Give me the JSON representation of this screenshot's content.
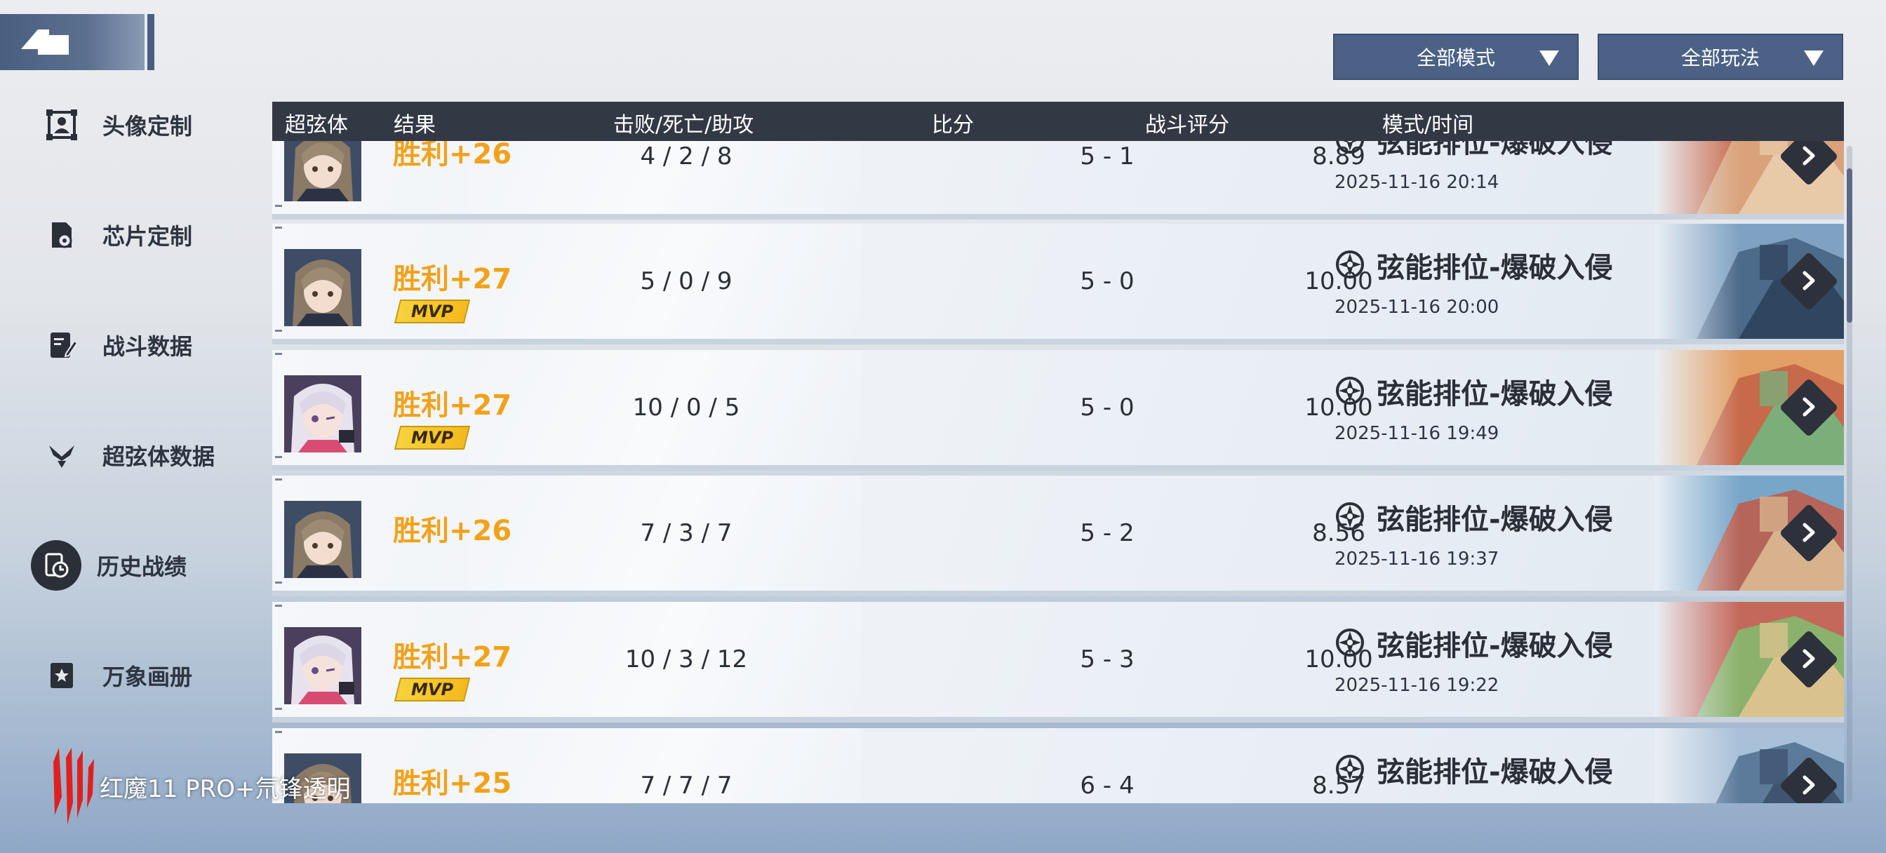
{
  "sidebar": {
    "items": [
      {
        "label": "头像定制",
        "icon": "portrait-frame-icon"
      },
      {
        "label": "芯片定制",
        "icon": "chip-icon"
      },
      {
        "label": "战斗数据",
        "icon": "battle-data-icon"
      },
      {
        "label": "超弦体数据",
        "icon": "superstring-icon"
      },
      {
        "label": "历史战绩",
        "icon": "history-clock-icon",
        "active": true
      },
      {
        "label": "万象画册",
        "icon": "album-icon"
      }
    ]
  },
  "filters": {
    "mode": "全部模式",
    "play": "全部玩法"
  },
  "table": {
    "headers": {
      "character": "超弦体",
      "result": "结果",
      "kda": "击败/死亡/助攻",
      "score": "比分",
      "rating": "战斗评分",
      "mode_time": "模式/时间"
    },
    "rows": [
      {
        "result": "胜利+26",
        "mvp": false,
        "kda": "4 / 2 / 8",
        "score": "5 - 1",
        "rating": "8.89",
        "mode": "弦能排位-爆破入侵",
        "time": "2025-11-16 20:14",
        "avatar": "brown"
      },
      {
        "result": "胜利+27",
        "mvp": true,
        "kda": "5 / 0 / 9",
        "score": "5 - 0",
        "rating": "10.00",
        "mode": "弦能排位-爆破入侵",
        "time": "2025-11-16 20:00",
        "avatar": "brown"
      },
      {
        "result": "胜利+27",
        "mvp": true,
        "kda": "10 / 0 / 5",
        "score": "5 - 0",
        "rating": "10.00",
        "mode": "弦能排位-爆破入侵",
        "time": "2025-11-16 19:49",
        "avatar": "white"
      },
      {
        "result": "胜利+26",
        "mvp": false,
        "kda": "7 / 3 / 7",
        "score": "5 - 2",
        "rating": "8.56",
        "mode": "弦能排位-爆破入侵",
        "time": "2025-11-16 19:37",
        "avatar": "brown"
      },
      {
        "result": "胜利+27",
        "mvp": true,
        "kda": "10 / 3 / 12",
        "score": "5 - 3",
        "rating": "10.00",
        "mode": "弦能排位-爆破入侵",
        "time": "2025-11-16 19:22",
        "avatar": "white"
      },
      {
        "result": "胜利+25",
        "mvp": false,
        "kda": "7 / 7 / 7",
        "score": "6 - 4",
        "rating": "8.57",
        "mode": "弦能排位-爆破入侵",
        "time": "",
        "avatar": "brown"
      }
    ],
    "mvp_label": "MVP"
  },
  "watermark": "红魔11 PRO+氘锋透明",
  "colors": {
    "win": "#f1a21a",
    "header_bg": "#323844",
    "dropdown_bg": "#4b6185",
    "mvp_bg": "#f6d23c"
  }
}
